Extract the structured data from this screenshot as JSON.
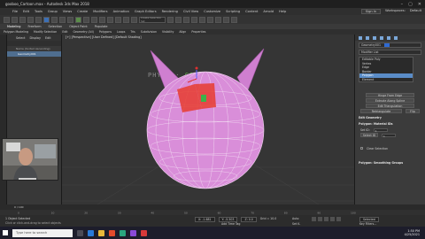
{
  "window": {
    "title": "gooboo_Cartoon.max - Autodesk 3ds Max 2018",
    "controls": [
      "–",
      "▢",
      "✕"
    ]
  },
  "menubar": {
    "items": [
      "File",
      "Edit",
      "Tools",
      "Group",
      "Views",
      "Create",
      "Modifiers",
      "Animation",
      "Graph Editors",
      "Rendering",
      "Civil View",
      "Customize",
      "Scripting",
      "Content",
      "Arnold",
      "Help"
    ],
    "sign_in": "Sign In",
    "workspaces_label": "Workspaces:",
    "workspace_value": "Default"
  },
  "toolbar": {
    "selection_set_placeholder": "Create Selection Set"
  },
  "ribbon": {
    "tabs": [
      "Modeling",
      "Freeform",
      "Selection",
      "Object Paint",
      "Populate"
    ],
    "active_tab": "Modeling",
    "subtabs": [
      "Polygon Modeling",
      "Modify Selection",
      "Edit",
      "Geometry (All)",
      "Polygons",
      "Loops",
      "Tris",
      "Subdivision",
      "Visibility",
      "Align",
      "Properties"
    ]
  },
  "explorer": {
    "menu": [
      "Select",
      "Display",
      "Edit"
    ],
    "header": "Name (Sorted Ascending)",
    "rows": [
      {
        "label": "Geometry001",
        "selected": true
      }
    ]
  },
  "viewport": {
    "label": "[+] [Perspective] [User Defined] [Default Shading]",
    "physx_text": "PHYSX",
    "physx_sep": "·",
    "physx_cpu": "CPU"
  },
  "command_panel": {
    "object_name": "Geometry001",
    "modifier_list": "Modifier List",
    "stack": [
      {
        "label": "Editable Poly",
        "selected": false
      },
      {
        "label": "Vertex",
        "selected": false
      },
      {
        "label": "Edge",
        "selected": false
      },
      {
        "label": "Border",
        "selected": false
      },
      {
        "label": "Polygon",
        "selected": true
      },
      {
        "label": "Element",
        "selected": false
      }
    ],
    "buttons": [
      "Hinge From Edge",
      "Extrude Along Spline",
      "Edit Triangulation",
      "Retriangulate",
      "Flip"
    ],
    "rollouts": [
      "Edit Geometry",
      "Polygon: Material IDs",
      "Polygon: Smoothing Groups"
    ],
    "set_id_label": "Set ID:",
    "set_id_value": "1",
    "select_id_label": "Select ID",
    "select_id_value": "1",
    "clear_selection_label": "Clear Selection",
    "accent_color": "#2f6ad1"
  },
  "timeline": {
    "frame_display": "0 / 100",
    "ticks": [
      "0",
      "10",
      "20",
      "30",
      "40",
      "50",
      "60",
      "70",
      "80",
      "90",
      "100"
    ]
  },
  "status": {
    "selected": "1 Object Selected",
    "hint": "Click or click-and-drag to select objects",
    "x": "X: -1.681",
    "y": "Y: -5.503",
    "z": "Z: 0.0",
    "grid": "Grid = 10.0",
    "add_time_tag": "Add Time Tag",
    "auto": "Auto",
    "set_key": "Set K.",
    "selected_dropdown": "Selected",
    "key_filters": "Key Filters..."
  },
  "taskbar": {
    "search_placeholder": "Type here to search",
    "time": "1:50 PM",
    "date": "4/25/2021"
  },
  "colors": {
    "sphere": "#d98ed9",
    "selection": "#e63c2e",
    "physx_cpu": "#63b14b"
  }
}
